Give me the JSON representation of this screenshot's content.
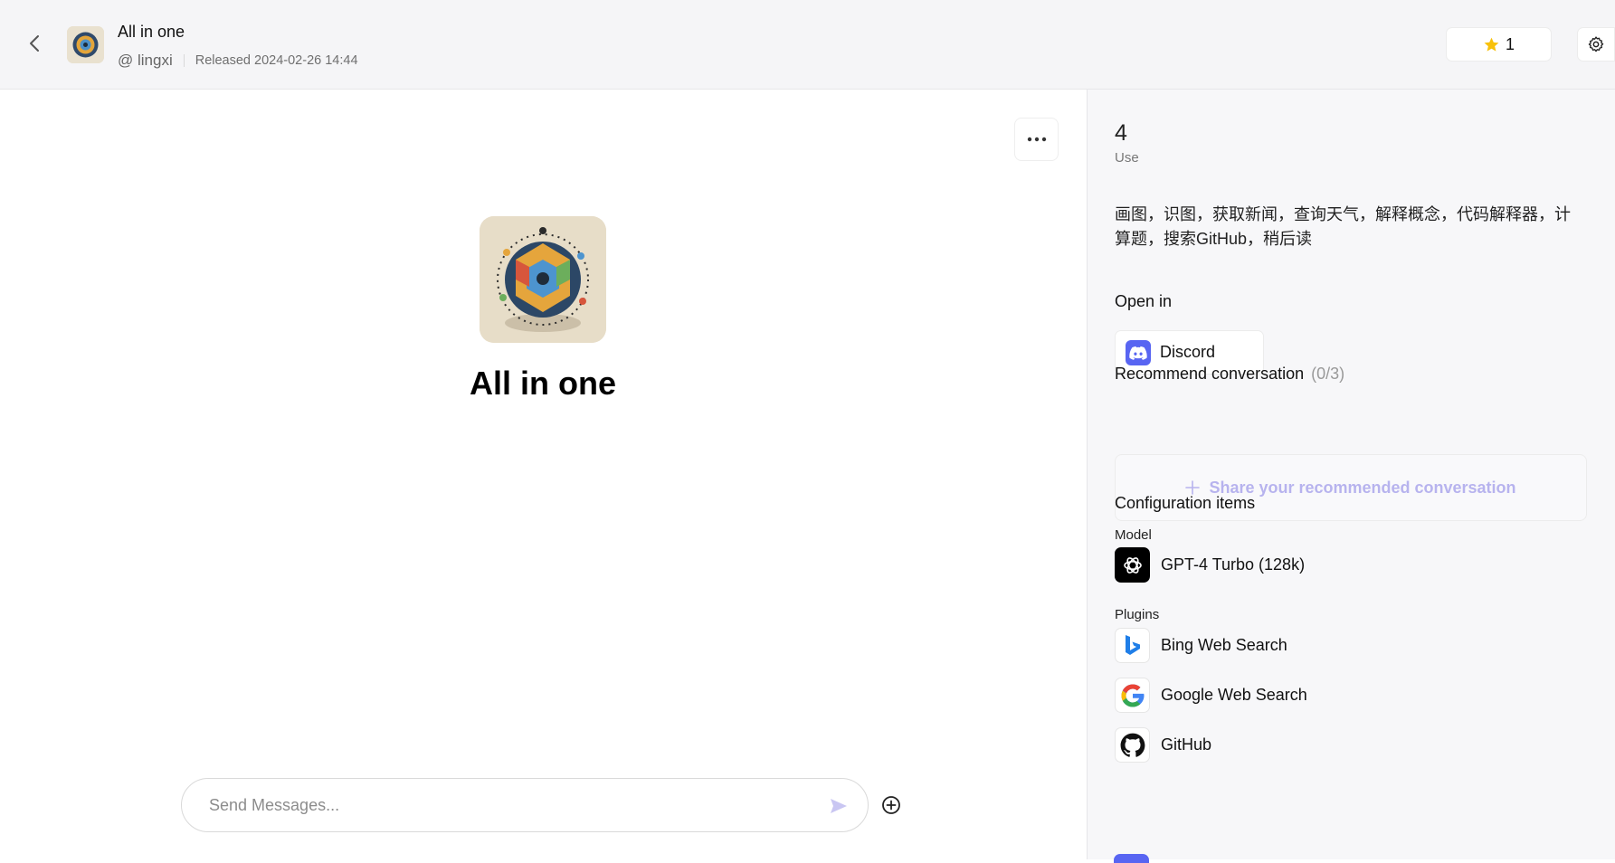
{
  "header": {
    "title": "All in one",
    "author": "@ lingxi",
    "released": "Released 2024-02-26 14:44",
    "star_count": "1"
  },
  "main": {
    "bot_name": "All in one",
    "input_placeholder": "Send Messages..."
  },
  "sidebar": {
    "use_count": "4",
    "use_label": "Use",
    "description": "画图，识图，获取新闻，查询天气，解释概念，代码解释器，计算题，搜索GitHub，稍后读",
    "open_in_title": "Open in",
    "open_in_items": [
      {
        "label": "Discord",
        "icon": "discord-icon"
      }
    ],
    "recommend_title": "Recommend conversation",
    "recommend_count": "(0/3)",
    "share_label": "Share your recommended conversation",
    "config_title": "Configuration items",
    "model_label": "Model",
    "model": {
      "name": "GPT-4 Turbo (128k)",
      "icon": "openai-icon"
    },
    "plugins_label": "Plugins",
    "plugins": [
      {
        "name": "Bing Web Search",
        "icon": "bing-icon"
      },
      {
        "name": "Google Web Search",
        "icon": "google-icon"
      },
      {
        "name": "GitHub",
        "icon": "github-icon"
      }
    ]
  },
  "colors": {
    "accent": "#b7b3ee",
    "discord": "#5865f2",
    "star": "#f8c10b",
    "header_bg": "#f5f5f7",
    "sidebar_bg": "#f7f7f9"
  }
}
